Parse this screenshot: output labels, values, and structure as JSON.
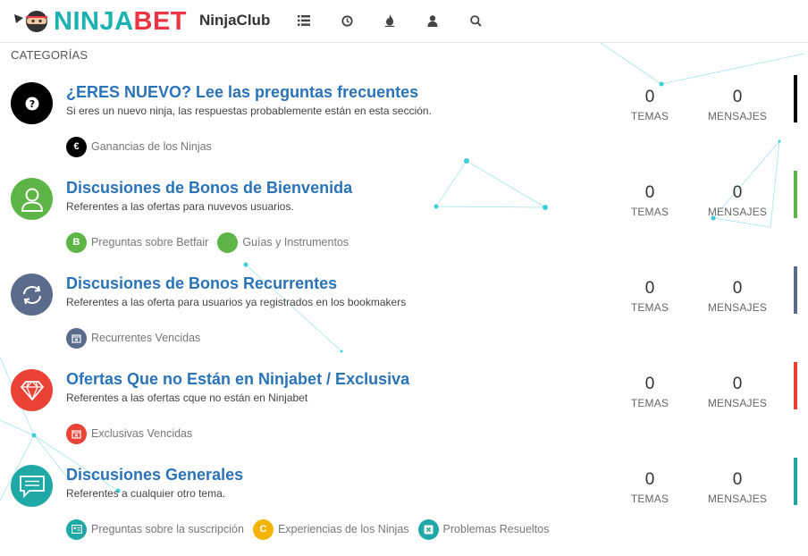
{
  "header": {
    "logo_ninja": "NINJA",
    "logo_bet": "BET",
    "club_name": "NinjaClub",
    "nav_icons": [
      "list-icon",
      "clock-icon",
      "fire-icon",
      "user-icon",
      "search-icon"
    ]
  },
  "section_title": "CATEGORÍAS",
  "stat_labels": {
    "topics": "TEMAS",
    "posts": "MENSAJES"
  },
  "categories": [
    {
      "title": "¿ERES NUEVO? Lee las preguntas frecuentes",
      "description": "Si eres un nuevo ninja, las respuestas probablemente están en esta sección.",
      "icon": "question-icon",
      "color": "#000000",
      "topics": "0",
      "posts": "0",
      "subcategories": [
        {
          "label": "Ganancias de los Ninjas",
          "icon": "euro-icon",
          "color": "#000000"
        }
      ]
    },
    {
      "title": "Discusiones de Bonos de Bienvenida",
      "description": "Referentes a las ofertas para nuvevos usuarios.",
      "icon": "user-outline-icon",
      "color": "#5cb545",
      "topics": "0",
      "posts": "0",
      "subcategories": [
        {
          "label": "Preguntas sobre Betfair",
          "icon": "b-letter-icon",
          "color": "#5cb545"
        },
        {
          "label": "Guías y Instrumentos",
          "icon": "dot-icon",
          "color": "#5cb545"
        }
      ]
    },
    {
      "title": "Discusiones de Bonos Recurrentes",
      "description": "Referentes a las oferta para usuarios ya registrados en los bookmakers",
      "icon": "refresh-icon",
      "color": "#5a6b8c",
      "topics": "0",
      "posts": "0",
      "subcategories": [
        {
          "label": "Recurrentes Vencidas",
          "icon": "calendar-x-icon",
          "color": "#5a6b8c"
        }
      ]
    },
    {
      "title": "Ofertas Que no Están en Ninjabet / Exclusiva",
      "description": "Referentes a las ofertas cque no están en Ninjabet",
      "icon": "diamond-icon",
      "color": "#ea4335",
      "topics": "0",
      "posts": "0",
      "subcategories": [
        {
          "label": "Exclusivas Vencidas",
          "icon": "calendar-x-icon",
          "color": "#ea4335"
        }
      ]
    },
    {
      "title": "Discusiones Generales",
      "description": "Referentes a cualquier otro tema.",
      "icon": "chat-icon",
      "color": "#1fa8a6",
      "topics": "0",
      "posts": "0",
      "subcategories": [
        {
          "label": "Preguntas sobre la suscripción",
          "icon": "id-card-icon",
          "color": "#1fa8a6"
        },
        {
          "label": "Experiencias de los Ninjas",
          "icon": "c-letter-icon",
          "color": "#f4b400"
        },
        {
          "label": "Problemas Resueltos",
          "icon": "close-box-icon",
          "color": "#1fa8a6"
        }
      ]
    }
  ]
}
